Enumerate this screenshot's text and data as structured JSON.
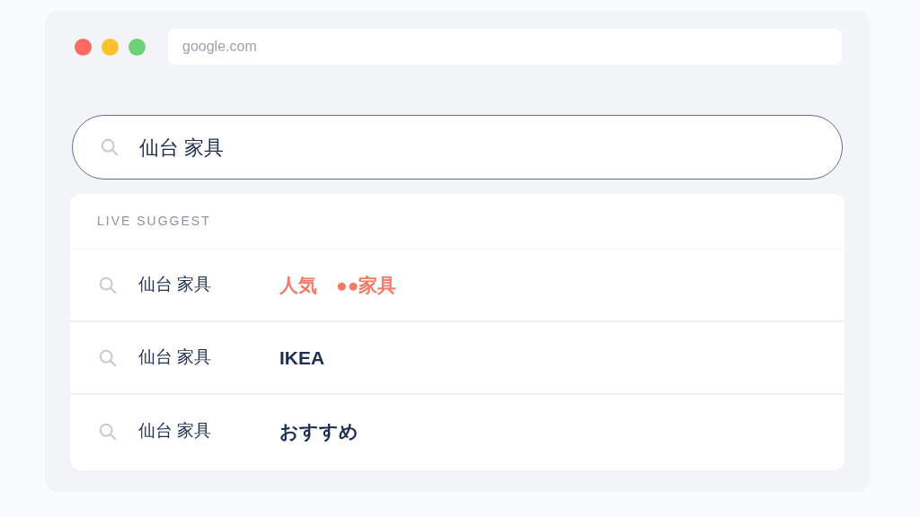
{
  "browser": {
    "window_controls": [
      {
        "color": "#ff6b61"
      },
      {
        "color": "#ffc22e"
      },
      {
        "color": "#6fd175"
      }
    ],
    "address": "google.com"
  },
  "search": {
    "value": "仙台 家具"
  },
  "suggest": {
    "heading": "LIVE SUGGEST",
    "items": [
      {
        "query": "仙台 家具",
        "suffix": "人気　●●家具",
        "color": "#f47a67"
      },
      {
        "query": "仙台 家具",
        "suffix": "IKEA",
        "color": "#1e2d50"
      },
      {
        "query": "仙台 家具",
        "suffix": "おすすめ",
        "color": "#1e2d50"
      }
    ]
  }
}
